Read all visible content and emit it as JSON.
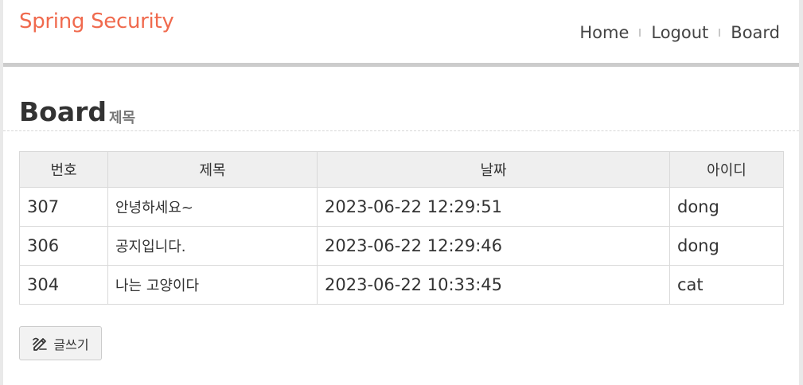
{
  "header": {
    "brand": "Spring Security",
    "nav": [
      "Home",
      "Logout",
      "Board"
    ]
  },
  "main": {
    "title": "Board",
    "subtitle": "제목",
    "columns": [
      "번호",
      "제목",
      "날짜",
      "아이디"
    ],
    "rows": [
      {
        "no": "307",
        "title": "안녕하세요~",
        "date": "2023-06-22 12:29:51",
        "id": "dong"
      },
      {
        "no": "306",
        "title": "공지입니다.",
        "date": "2023-06-22 12:29:46",
        "id": "dong"
      },
      {
        "no": "304",
        "title": "나는 고양이다",
        "date": "2023-06-22 10:33:45",
        "id": "cat"
      }
    ],
    "write_button": {
      "label": "글쓰기",
      "icon": "pencil-icon"
    }
  },
  "colors": {
    "brand": "#f06a4e",
    "header_border": "#cccccc",
    "table_header_bg": "#efefef"
  }
}
